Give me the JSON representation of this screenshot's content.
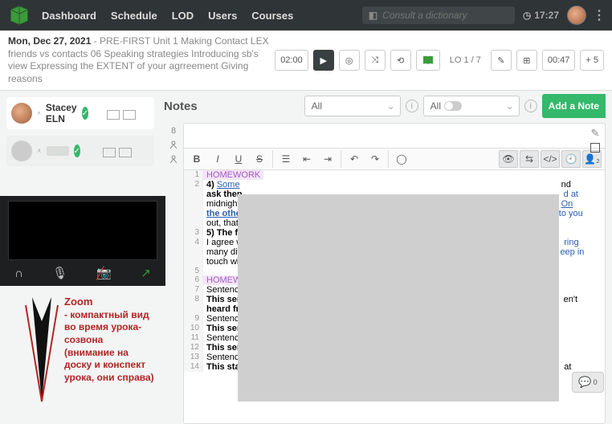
{
  "nav": {
    "dashboard": "Dashboard",
    "schedule": "Schedule",
    "lod": "LOD",
    "users": "Users",
    "courses": "Courses"
  },
  "search": {
    "placeholder": "Consult a dictionary"
  },
  "clock": "17:27",
  "lesson": {
    "date": "Mon, Dec 27, 2021",
    "desc": " - PRE-FIRST Unit 1 Making Contact LEX friends vs contacts 06 Speaking strategies Introducing sb's view Expressing the EXTENT of your agrreement Giving reasons"
  },
  "controls": {
    "t1": "02:00",
    "lo": "LO 1 / 7",
    "t2": "00:47",
    "plus": "+ 5"
  },
  "users": {
    "u1": "Stacey ELN"
  },
  "notes": {
    "title": "Notes",
    "filter1": "All",
    "filter2": "All",
    "add": "Add a Note",
    "count": "8"
  },
  "toolbar": {
    "b": "B",
    "i": "I",
    "u": "U"
  },
  "lines": {
    "l1": "HOMEWORK",
    "l2a": "4) ",
    "l2b": "Some",
    "l2c": "nd",
    "l3a": "ask then",
    "l3b": "d at",
    "l4a": "midnight",
    "l4b": "On",
    "l5a": "the othe",
    "l5b": "to you",
    "l5c": "out, that i",
    "l6": "5) The fr",
    "l7a": "I agree w",
    "l7b": "ring",
    "l8a": "many diff",
    "l8b": "eep in",
    "l8c": "touch wit",
    "l9": "HOMEW",
    "l10": "Sentence",
    "l11a": "This sen",
    "l11b": "en't",
    "l12": "heard fro",
    "l13": "Sentence",
    "l14": "This sen",
    "l15": "Sentenc",
    "l16": "This sent",
    "l17": "Sentence",
    "l18": "This stat",
    "l18b": "at"
  },
  "zoom": {
    "title": "Zoom",
    "l1": "- компактный вид",
    "l2": "во время урока-",
    "l3": "созвона",
    "l4": "(внимание на",
    "l5": "доску и конспект",
    "l6": "урока, они справа)"
  }
}
